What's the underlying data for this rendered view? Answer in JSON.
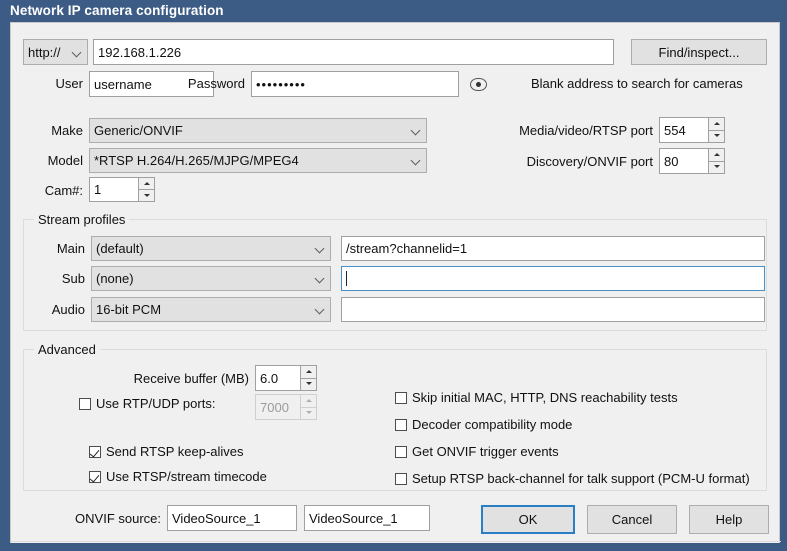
{
  "window": {
    "title": "Network IP camera configuration",
    "titlebar_color": "#3d5c85",
    "client_bg": "#f0f0f0",
    "accent_color": "#2a7fc4"
  },
  "address": {
    "scheme_value": "http://",
    "scheme_icon": "chevron-down-icon",
    "host_value": "192.168.1.226",
    "find_button_label": "Find/inspect..."
  },
  "credentials": {
    "user_label": "User",
    "user_value": "username",
    "password_label": "Password",
    "password_value": "•••••••••",
    "reveal_icon": "eye-icon",
    "hint": "Blank address to search for cameras"
  },
  "device": {
    "make_label": "Make",
    "make_value": "Generic/ONVIF",
    "model_label": "Model",
    "model_value": "*RTSP H.264/H.265/MJPG/MPEG4",
    "cam_label": "Cam#:",
    "cam_value": "1"
  },
  "ports": {
    "media_label": "Media/video/RTSP port",
    "media_value": "554",
    "discovery_label": "Discovery/ONVIF port",
    "discovery_value": "80"
  },
  "stream_profiles": {
    "title": "Stream profiles",
    "rows": [
      {
        "label": "Main",
        "profile": "(default)",
        "path": "/stream?channelid=1",
        "focused": false,
        "placeholder": ""
      },
      {
        "label": "Sub",
        "profile": "(none)",
        "path": "",
        "focused": true,
        "placeholder": ""
      },
      {
        "label": "Audio",
        "profile": "16-bit PCM",
        "path": "",
        "focused": false,
        "placeholder": ""
      }
    ]
  },
  "advanced": {
    "title": "Advanced",
    "receive_buffer_label": "Receive buffer (MB)",
    "receive_buffer_value": "6.0",
    "rtp_udp_label": "Use RTP/UDP ports:",
    "rtp_udp_checked": false,
    "rtp_udp_port_value": "7000",
    "rtp_udp_port_disabled": true,
    "left_checks": [
      {
        "label": "Send RTSP keep-alives",
        "checked": true
      },
      {
        "label": "Use RTSP/stream timecode",
        "checked": true
      }
    ],
    "right_checks": [
      {
        "label": "Skip initial MAC, HTTP, DNS reachability tests",
        "checked": false
      },
      {
        "label": "Decoder compatibility mode",
        "checked": false
      },
      {
        "label": "Get ONVIF trigger events",
        "checked": false
      },
      {
        "label": "Setup RTSP back-channel for talk support (PCM-U format)",
        "checked": false
      }
    ]
  },
  "footer": {
    "onvif_source_label": "ONVIF source:",
    "onvif_source_value_1": "VideoSource_1",
    "onvif_source_value_2": "VideoSource_1",
    "ok_label": "OK",
    "cancel_label": "Cancel",
    "help_label": "Help"
  }
}
